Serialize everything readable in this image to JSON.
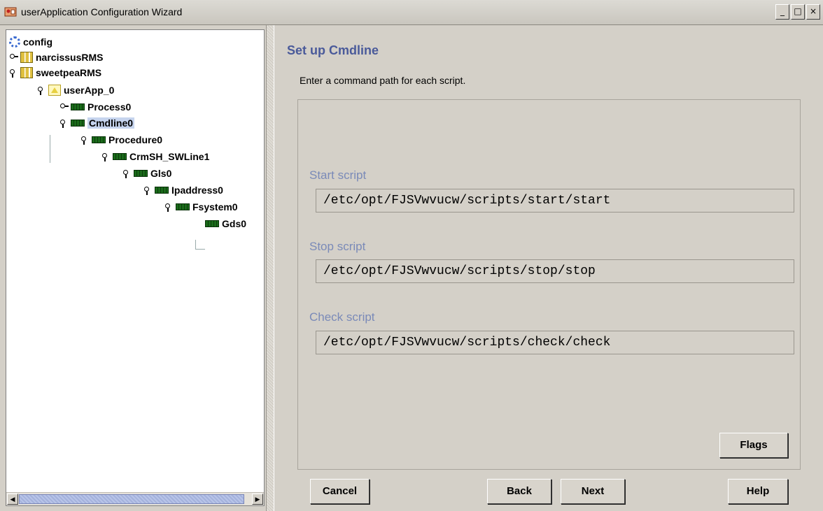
{
  "window": {
    "title": "userApplication Configuration Wizard",
    "minimize": "_",
    "maximize": "□",
    "close": "×"
  },
  "tree": {
    "items": [
      {
        "label": "config",
        "icon": "config-icon"
      },
      {
        "label": "narcissusRMS",
        "icon": "rms-icon"
      },
      {
        "label": "sweetpeaRMS",
        "icon": "rms-icon"
      },
      {
        "label": "userApp_0",
        "icon": "userapp-icon"
      },
      {
        "label": "Process0",
        "icon": "resource-icon"
      },
      {
        "label": "Cmdline0",
        "icon": "resource-icon",
        "selected": true
      },
      {
        "label": "Procedure0",
        "icon": "resource-icon"
      },
      {
        "label": "CrmSH_SWLine1",
        "icon": "resource-icon"
      },
      {
        "label": "Gls0",
        "icon": "resource-icon"
      },
      {
        "label": "Ipaddress0",
        "icon": "resource-icon"
      },
      {
        "label": "Fsystem0",
        "icon": "resource-icon"
      },
      {
        "label": "Gds0",
        "icon": "resource-icon"
      }
    ],
    "scroll_left": "◀",
    "scroll_right": "▶"
  },
  "main": {
    "heading": "Set up Cmdline",
    "description": "Enter a command path for each script.",
    "start_label": "Start script",
    "start_value": "/etc/opt/FJSVwvucw/scripts/start/start",
    "stop_label": "Stop script",
    "stop_value": "/etc/opt/FJSVwvucw/scripts/stop/stop",
    "check_label": "Check script",
    "check_value": "/etc/opt/FJSVwvucw/scripts/check/check",
    "flags_label": "Flags"
  },
  "buttons": {
    "cancel": "Cancel",
    "back": "Back",
    "next": "Next",
    "help": "Help"
  },
  "colors": {
    "heading": "#4a5a9a",
    "field_label": "#7a8ab8",
    "selection": "#c6d4ee",
    "resource_icon": "#1a6b1a"
  }
}
